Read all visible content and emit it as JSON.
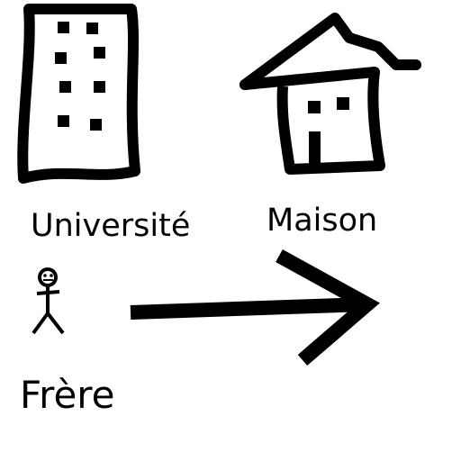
{
  "labels": {
    "university": "Université",
    "house": "Maison",
    "brother": "Frère"
  },
  "colors": {
    "ink": "#000000",
    "background": "#ffffff"
  },
  "icons": [
    "university-building-icon",
    "house-icon",
    "stick-figure-icon",
    "arrow-right-icon"
  ]
}
